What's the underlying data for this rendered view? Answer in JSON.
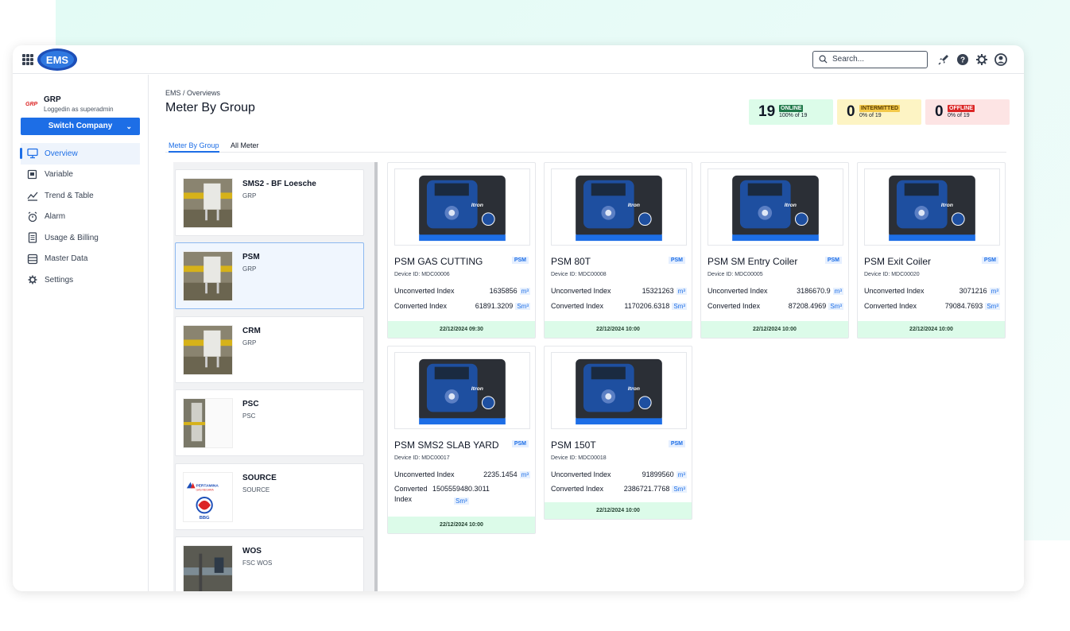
{
  "topbar": {
    "search_placeholder": "Search...",
    "logo_text": "EMS"
  },
  "sidebar": {
    "company_logo": "GRP",
    "company_name": "GRP",
    "login_text": "Loggedin as superadmin",
    "switch_label": "Switch Company",
    "items": [
      {
        "label": "Overview",
        "icon": "monitor-icon",
        "active": true
      },
      {
        "label": "Variable",
        "icon": "variable-icon"
      },
      {
        "label": "Trend & Table",
        "icon": "trend-icon"
      },
      {
        "label": "Alarm",
        "icon": "alarm-icon"
      },
      {
        "label": "Usage & Billing",
        "icon": "billing-icon"
      },
      {
        "label": "Master Data",
        "icon": "database-icon"
      },
      {
        "label": "Settings",
        "icon": "gear-icon"
      }
    ]
  },
  "main": {
    "breadcrumb": "EMS / Overviews",
    "title": "Meter By Group",
    "stats": {
      "online": {
        "count": "19",
        "label": "ONLINE",
        "pct": "100% of 19",
        "color": "#1f7a4a"
      },
      "intermitted": {
        "count": "0",
        "label": "INTERMITTED",
        "pct": "0% of 19",
        "color": "#b7791f"
      },
      "offline": {
        "count": "0",
        "label": "OFFLINE",
        "pct": "0% of 19",
        "color": "#dc2626"
      }
    },
    "tabs": [
      "Meter By Group",
      "All Meter"
    ],
    "groups": [
      {
        "name": "SMS2 - BF Loesche",
        "sub": "GRP"
      },
      {
        "name": "PSM",
        "sub": "GRP"
      },
      {
        "name": "CRM",
        "sub": "GRP"
      },
      {
        "name": "PSC",
        "sub": "PSC"
      },
      {
        "name": "SOURCE",
        "sub": "SOURCE",
        "logo_text": "PERTAMINA",
        "logo_sub": "GAS NEGARA",
        "logo_badge": "BBG"
      },
      {
        "name": "WOS",
        "sub": "FSC WOS"
      }
    ],
    "meter_brand": "Itron",
    "meters": [
      {
        "name": "PSM GAS CUTTING",
        "tag": "PSM",
        "device": "Device ID: MDC00006",
        "unconv_label": "Unconverted Index",
        "unconv": "1635856",
        "unconv_unit": "m³",
        "conv_label": "Converted Index",
        "conv": "61891.3209",
        "conv_unit": "Sm³",
        "ts": "22/12/2024 09:30"
      },
      {
        "name": "PSM 80T",
        "tag": "PSM",
        "device": "Device ID: MDC00008",
        "unconv_label": "Unconverted Index",
        "unconv": "15321263",
        "unconv_unit": "m³",
        "conv_label": "Converted Index",
        "conv": "1170206.6318",
        "conv_unit": "Sm³",
        "ts": "22/12/2024 10:00"
      },
      {
        "name": "PSM SM Entry Coiler",
        "tag": "PSM",
        "device": "Device ID: MDC00005",
        "unconv_label": "Unconverted Index",
        "unconv": "3186670.9",
        "unconv_unit": "m³",
        "conv_label": "Converted Index",
        "conv": "87208.4969",
        "conv_unit": "Sm³",
        "ts": "22/12/2024 10:00"
      },
      {
        "name": "PSM Exit Coiler",
        "tag": "PSM",
        "device": "Device ID: MDC00020",
        "unconv_label": "Unconverted Index",
        "unconv": "3071216",
        "unconv_unit": "m³",
        "conv_label": "Converted Index",
        "conv": "79084.7693",
        "conv_unit": "Sm³",
        "ts": "22/12/2024 10:00"
      },
      {
        "name": "PSM SMS2 SLAB YARD",
        "tag": "PSM",
        "device": "Device ID: MDC00017",
        "unconv_label": "Unconverted Index",
        "unconv": "2235.1454",
        "unconv_unit": "m³",
        "conv_label_1": "Converted",
        "conv_label_2": "Index",
        "conv": "1505559480.3011",
        "conv_unit": "Sm³",
        "ts": "22/12/2024 10:00"
      },
      {
        "name": "PSM 150T",
        "tag": "PSM",
        "device": "Device ID: MDC00018",
        "unconv_label": "Unconverted Index",
        "unconv": "91899560",
        "unconv_unit": "m³",
        "conv_label": "Converted Index",
        "conv": "2386721.7768",
        "conv_unit": "Sm³",
        "ts": "22/12/2024 10:00"
      }
    ]
  }
}
